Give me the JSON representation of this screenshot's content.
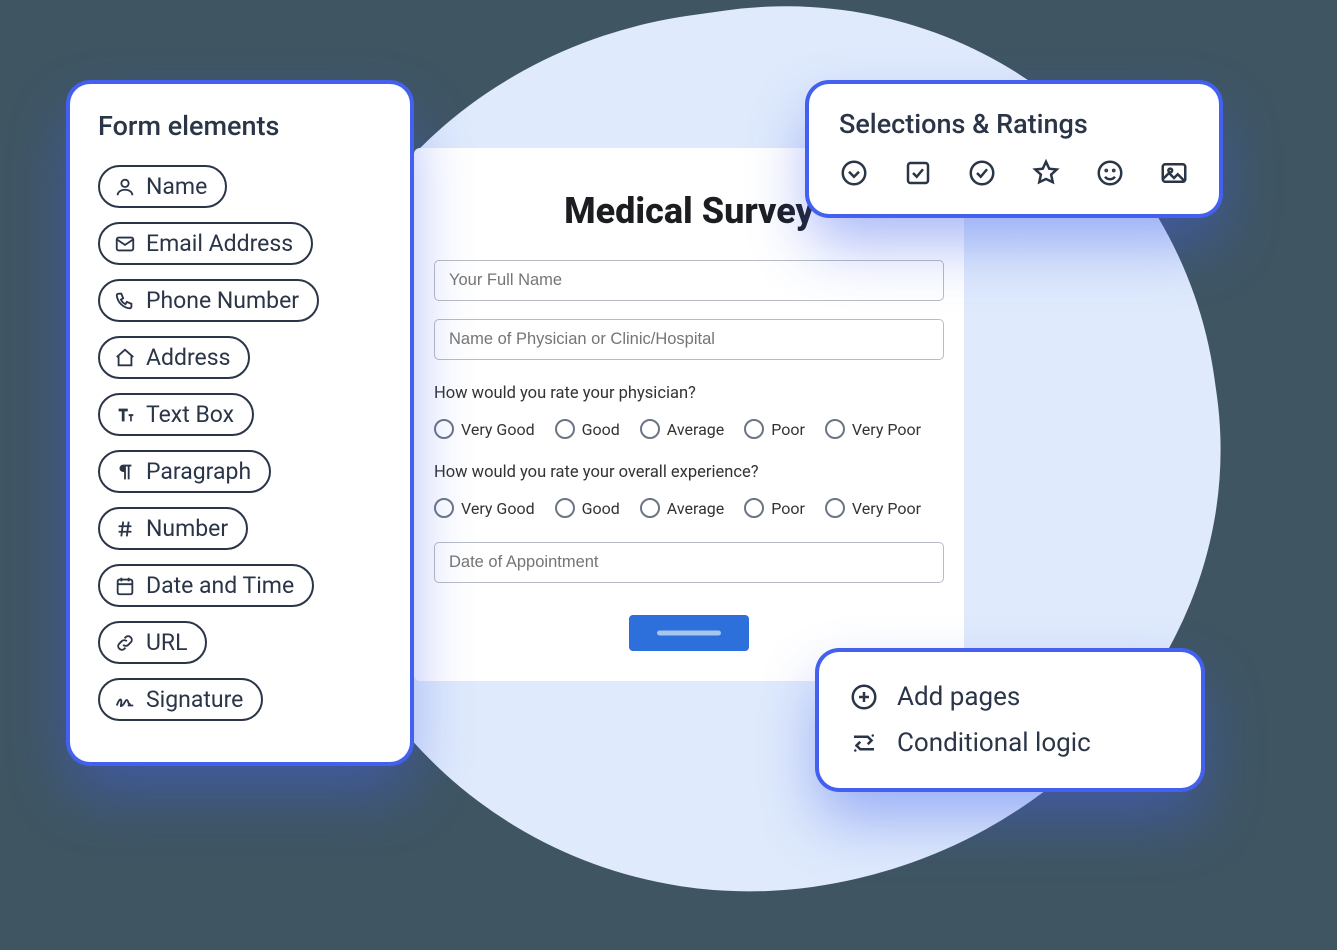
{
  "form_elements": {
    "title": "Form elements",
    "items": [
      {
        "label": "Name",
        "icon": "person-icon"
      },
      {
        "label": "Email Address",
        "icon": "mail-icon"
      },
      {
        "label": "Phone Number",
        "icon": "phone-icon"
      },
      {
        "label": "Address",
        "icon": "home-icon"
      },
      {
        "label": "Text Box",
        "icon": "textbox-icon"
      },
      {
        "label": "Paragraph",
        "icon": "paragraph-icon"
      },
      {
        "label": "Number",
        "icon": "hash-icon"
      },
      {
        "label": "Date and Time",
        "icon": "calendar-icon"
      },
      {
        "label": "URL",
        "icon": "link-icon"
      },
      {
        "label": "Signature",
        "icon": "signature-icon"
      }
    ]
  },
  "ratings": {
    "title": "Selections & Ratings",
    "icons": [
      "dropdown-icon",
      "checkbox-icon",
      "radio-circle-icon",
      "star-icon",
      "smiley-icon",
      "image-picker-icon"
    ]
  },
  "survey": {
    "title": "Medical Survey",
    "inputs": {
      "full_name": "Your Full Name",
      "physician_name": "Name of Physician or Clinic/Hospital",
      "appointment_date": "Date of Appointment"
    },
    "q1": "How would you rate your physician?",
    "q2": "How would you rate your overall experience?",
    "options": [
      "Very Good",
      "Good",
      "Average",
      "Poor",
      "Very Poor"
    ]
  },
  "actions": {
    "add_pages": "Add pages",
    "conditional_logic": "Conditional logic"
  }
}
